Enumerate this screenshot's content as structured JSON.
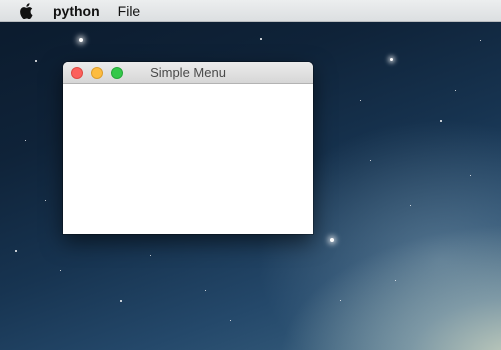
{
  "menubar": {
    "apple_icon": "apple-icon",
    "app_name": "python",
    "items": [
      "File"
    ]
  },
  "window": {
    "title": "Simple Menu",
    "controls": {
      "close_color": "#fc605c",
      "minimize_color": "#fdbc40",
      "maximize_color": "#34c84a"
    }
  }
}
